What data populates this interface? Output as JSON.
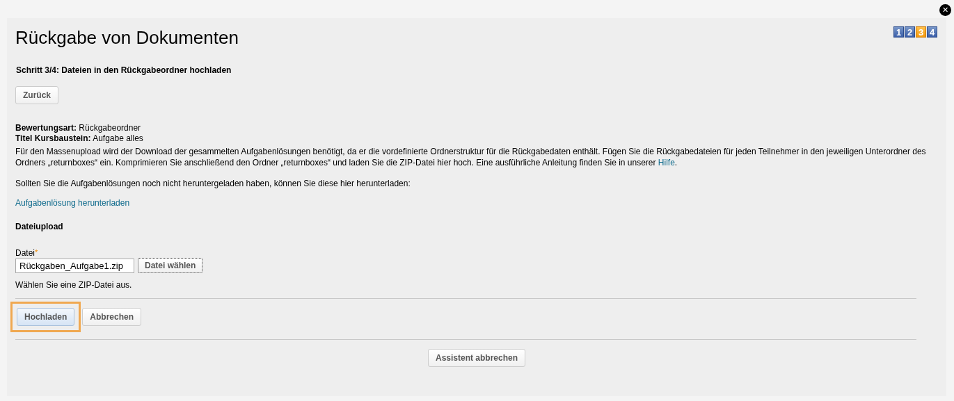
{
  "dialog": {
    "title": "Rückgabe von Dokumenten",
    "close_label": "✕"
  },
  "steps": [
    {
      "label": "1",
      "selected": false
    },
    {
      "label": "2",
      "selected": false
    },
    {
      "label": "3",
      "selected": true
    },
    {
      "label": "4",
      "selected": false
    }
  ],
  "step_heading": "Schritt 3/4: Dateien in den Rückgabeordner hochladen",
  "back_button": "Zurück",
  "info": [
    {
      "label": "Bewertungsart:",
      "value": "Rückgabeordner"
    },
    {
      "label": "Titel Kursbaustein:",
      "value": "Aufgabe alles"
    }
  ],
  "description": {
    "text": "Für den Massenupload wird der Download der gesammelten Aufgabenlösungen benötigt, da er die vordefinierte Ordnerstruktur für die Rückgabedaten enthält. Fügen Sie die Rückgabedateien für jeden Teilnehmer in den jeweiligen Unterordner des Ordners „returnboxes“ ein. Komprimieren Sie anschließend den Ordner „returnboxes“ und laden Sie die ZIP-Datei hier hoch. Eine ausführliche Anleitung finden Sie in unserer ",
    "link": "Hilfe",
    "end": "."
  },
  "download_hint": "Sollten Sie die Aufgabenlösungen noch nicht heruntergeladen haben, können Sie diese hier herunterladen:",
  "download_link": "Aufgabenlösung herunterladen",
  "upload": {
    "heading": "Dateiupload",
    "label": "Datei",
    "required_mark": "*",
    "value": "Rückgaben_Aufgabe1.zip",
    "choose_button": "Datei wählen",
    "hint": "Wählen Sie eine ZIP-Datei aus."
  },
  "actions": [
    {
      "label": "Hochladen",
      "focused": true
    },
    {
      "label": "Abbrechen",
      "focused": false
    }
  ],
  "wizard_cancel": "Assistent abbrechen"
}
